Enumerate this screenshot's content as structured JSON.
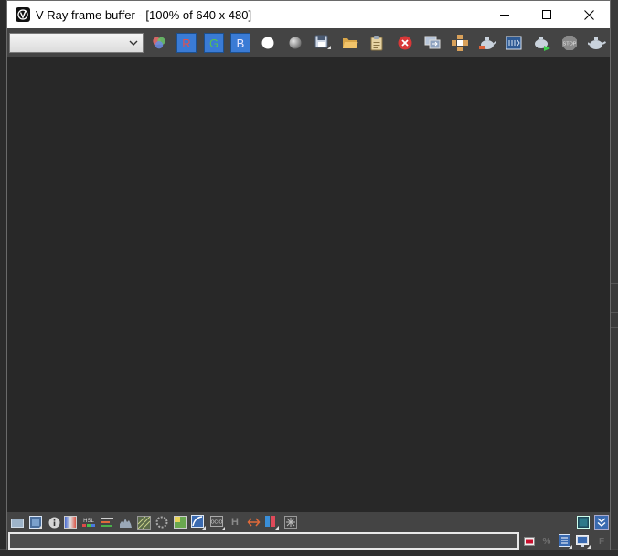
{
  "window": {
    "title": "V-Ray frame buffer - [100% of 640 x 480]",
    "controls": {
      "minimize": "minimize-icon",
      "maximize": "maximize-icon",
      "close": "close-icon"
    }
  },
  "toolbar": {
    "channel_select": {
      "value": ""
    },
    "channel_buttons": [
      {
        "label": "R",
        "color": "#e05050"
      },
      {
        "label": "G",
        "color": "#54c254"
      },
      {
        "label": "B",
        "color": "#e8e8ff"
      }
    ],
    "icons": [
      "color-correction-icon",
      "view-red-channel-icon",
      "view-green-channel-icon",
      "view-blue-channel-icon",
      "alpha-channel-icon",
      "monochrome-icon",
      "save-image-icon",
      "load-image-icon",
      "duplicate-to-mtl-editor-icon",
      "clear-image-icon",
      "link-to-vfb-icon",
      "region-render-icon",
      "render-last-icon",
      "show-vfb-history-icon",
      "interactive-render-icon",
      "stop-render-icon",
      "render-icon"
    ]
  },
  "viewport": {
    "background": "#282828"
  },
  "bottom_toolbar": {
    "h_label": "H",
    "icons": [
      "open-folder-icon",
      "image-info-icon",
      "info-icon",
      "color-levels-icon",
      "hsl-icon",
      "curves-icon",
      "histogram-icon",
      "exposure-icon",
      "white-balance-icon",
      "lut-icon",
      "color-curve-icon",
      "ocio-icon",
      "h-icon",
      "compare-ab-icon",
      "split-view-icon",
      "pixel-info-icon",
      "show-panel-icon",
      "expand-icon"
    ]
  },
  "status_bar": {
    "field_value": "",
    "icons": [
      "flag-icon",
      "percent-icon",
      "list-icon",
      "monitor-icon",
      "f-icon"
    ],
    "percent_label": "%",
    "f_label": "F"
  }
}
